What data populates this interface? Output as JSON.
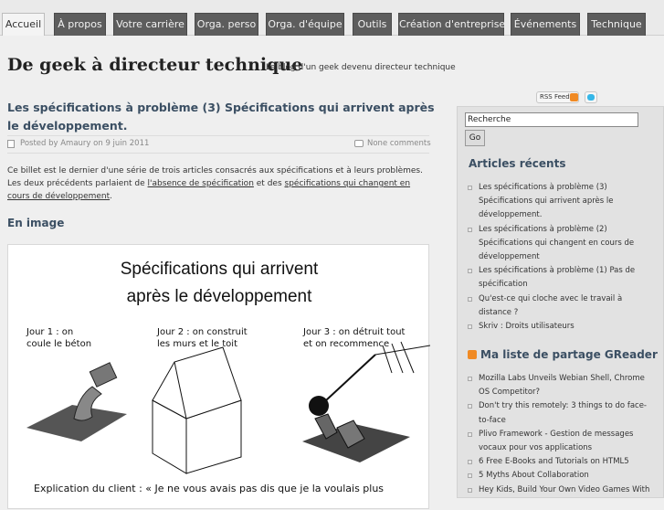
{
  "nav": {
    "tabs": [
      {
        "label": "Accueil",
        "active": true
      },
      {
        "label": "À propos"
      },
      {
        "label": "Votre carrière"
      },
      {
        "label": "Orga. perso"
      },
      {
        "label": "Orga. d'équipe"
      },
      {
        "label": "Outils"
      },
      {
        "label": "Création d'entreprise"
      },
      {
        "label": "Événements"
      },
      {
        "label": "Technique"
      }
    ]
  },
  "site": {
    "title": "De geek à directeur technique",
    "description": "Le blog d'un geek devenu directeur technique"
  },
  "post": {
    "title": "Les spécifications à problème (3) Spécifications qui arrivent après le développement.",
    "meta_posted": "Posted by Amaury on 9 juin 2011",
    "meta_comments": "None comments",
    "intro_part1": "Ce billet est le dernier d'une série de trois articles consacrés aux spécifications et à leurs problèmes. Les deux précédents parlaient de ",
    "intro_link1": "l'absence de spécification",
    "intro_part2": " et des ",
    "intro_link2": "spécifications qui changent en cours de développement",
    "intro_part3": ".",
    "section_heading": "En image"
  },
  "figure": {
    "title_line1": "Spécifications qui arrivent",
    "title_line2": "après le développement",
    "day1_line1": "Jour 1 : on",
    "day1_line2": "coule le béton",
    "day2_line1": "Jour 2 : on construit",
    "day2_line2": "les murs et le toit",
    "day3_line1": "Jour 3 : on détruit tout",
    "day3_line2": "et on recommence",
    "explanation": "Explication du client : « Je ne vous avais pas dis que je la voulais plus"
  },
  "sidebar": {
    "rss_label": "RSS Feed",
    "search_value": "Recherche",
    "search_button": "Go",
    "recent_title": "Articles récents",
    "recent_items": [
      "Les spécifications à problème (3) Spécifications qui arrivent après le développement.",
      "Les spécifications à problème (2) Spécifications qui changent en cours de développement",
      "Les spécifications à problème (1) Pas de spécification",
      "Qu'est-ce qui cloche avec le travail à distance ?",
      "Skriv : Droits utilisateurs"
    ],
    "share_title": "Ma liste de partage GReader",
    "share_items": [
      "Mozilla Labs Unveils Webian Shell, Chrome OS Competitor?",
      "Don't try this remotely: 3 things to do face-to-face",
      "Plivo Framework - Gestion de messages vocaux pour vos applications",
      "6 Free E-Books and Tutorials on HTML5",
      "5 Myths About Collaboration",
      "Hey Kids, Build Your Own Video Games With"
    ]
  },
  "colors": {
    "nav_tab": "#5d5d5d",
    "nav_tab_active": "#f4f4f4",
    "heading": "#3b4f63",
    "rss": "#f08a24",
    "twitter": "#35b7e8"
  }
}
